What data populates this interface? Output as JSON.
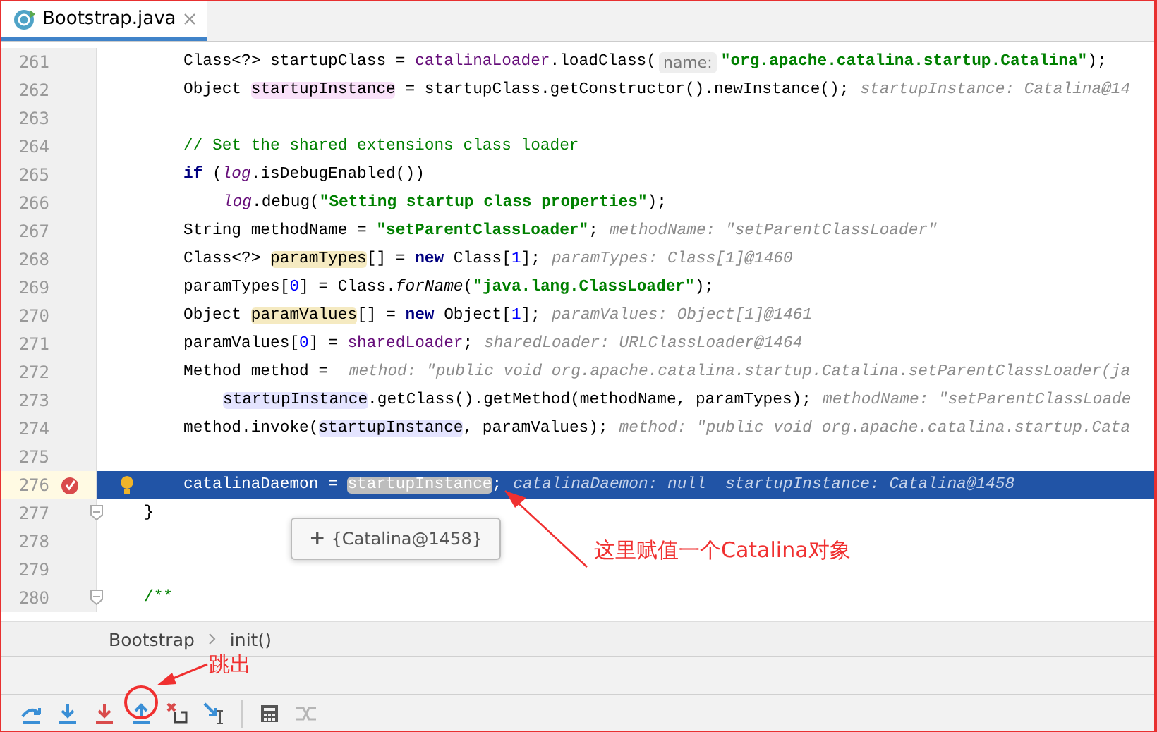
{
  "tabs": [
    {
      "label": "Bootstrap.java",
      "selected": true
    }
  ],
  "lines": [
    {
      "number": "261",
      "kind": "statement",
      "tokens": [
        {
          "text": "Class<?> startupClass = ",
          "kind": "plain"
        },
        {
          "text": "catalinaLoader",
          "kind": "field"
        },
        {
          "text": ".loadClass(",
          "kind": "plain"
        },
        {
          "text": "name:",
          "kind": "param"
        },
        {
          "text": "\"org.apache.catalina.startup.Catalina\"",
          "kind": "string"
        },
        {
          "text": ");",
          "kind": "plain"
        }
      ]
    },
    {
      "number": "262",
      "kind": "statement",
      "tokens": [
        {
          "text": "Object ",
          "kind": "plain"
        },
        {
          "text": "startupInstance",
          "kind": "plain",
          "declaration": true
        },
        {
          "text": " = startupClass.getConstructor().newInstance();",
          "kind": "plain"
        },
        {
          "text": "startupInstance: Catalina@14",
          "kind": "hint"
        }
      ]
    },
    {
      "number": "263",
      "kind": "statement"
    },
    {
      "number": "264",
      "kind": "statement",
      "tokens": [
        {
          "text": "// Set the shared extensions class loader",
          "kind": "comment"
        }
      ]
    },
    {
      "number": "265",
      "kind": "statement",
      "tokens": [
        {
          "text": "if",
          "kind": "keyword"
        },
        {
          "text": " (",
          "kind": "plain"
        },
        {
          "text": "log",
          "kind": "staticfield"
        },
        {
          "text": ".isDebugEnabled())",
          "kind": "plain"
        }
      ]
    },
    {
      "number": "266",
      "kind": "continuation",
      "tokens": [
        {
          "text": "log",
          "kind": "staticfield"
        },
        {
          "text": ".debug(",
          "kind": "plain"
        },
        {
          "text": "\"Setting startup class properties\"",
          "kind": "string"
        },
        {
          "text": ");",
          "kind": "plain"
        }
      ]
    },
    {
      "number": "267",
      "kind": "statement",
      "tokens": [
        {
          "text": "String methodName = ",
          "kind": "plain"
        },
        {
          "text": "\"setParentClassLoader\"",
          "kind": "string"
        },
        {
          "text": ";",
          "kind": "plain"
        },
        {
          "text": "methodName: \"setParentClassLoader\"",
          "kind": "hint"
        }
      ]
    },
    {
      "number": "268",
      "kind": "statement",
      "tokens": [
        {
          "text": "Class<?> ",
          "kind": "plain"
        },
        {
          "text": "paramTypes",
          "kind": "plain",
          "write_access": true
        },
        {
          "text": "[] = ",
          "kind": "plain"
        },
        {
          "text": "new",
          "kind": "keyword"
        },
        {
          "text": " Class[",
          "kind": "plain"
        },
        {
          "text": "1",
          "kind": "number"
        },
        {
          "text": "];",
          "kind": "plain"
        },
        {
          "text": "paramTypes: Class[1]@1460",
          "kind": "hint"
        }
      ]
    },
    {
      "number": "269",
      "kind": "statement",
      "tokens": [
        {
          "text": "paramTypes[",
          "kind": "plain"
        },
        {
          "text": "0",
          "kind": "number"
        },
        {
          "text": "] = Class.",
          "kind": "plain"
        },
        {
          "text": "forName",
          "kind": "static"
        },
        {
          "text": "(",
          "kind": "plain"
        },
        {
          "text": "\"java.lang.ClassLoader\"",
          "kind": "string"
        },
        {
          "text": ");",
          "kind": "plain"
        }
      ]
    },
    {
      "number": "270",
      "kind": "statement",
      "tokens": [
        {
          "text": "Object ",
          "kind": "plain"
        },
        {
          "text": "paramValues",
          "kind": "plain",
          "write_access": true
        },
        {
          "text": "[] = ",
          "kind": "plain"
        },
        {
          "text": "new",
          "kind": "keyword"
        },
        {
          "text": " Object[",
          "kind": "plain"
        },
        {
          "text": "1",
          "kind": "number"
        },
        {
          "text": "];",
          "kind": "plain"
        },
        {
          "text": "paramValues: Object[1]@1461",
          "kind": "hint"
        }
      ]
    },
    {
      "number": "271",
      "kind": "statement",
      "tokens": [
        {
          "text": "paramValues[",
          "kind": "plain"
        },
        {
          "text": "0",
          "kind": "number"
        },
        {
          "text": "] = ",
          "kind": "plain"
        },
        {
          "text": "sharedLoader",
          "kind": "field"
        },
        {
          "text": ";",
          "kind": "plain"
        },
        {
          "text": "sharedLoader: URLClassLoader@1464",
          "kind": "hint"
        }
      ]
    },
    {
      "number": "272",
      "kind": "statement",
      "tokens": [
        {
          "text": "Method method = ",
          "kind": "plain"
        },
        {
          "text": "method: \"public void org.apache.catalina.startup.Catalina.setParentClassLoader(ja",
          "kind": "hint"
        }
      ]
    },
    {
      "number": "273",
      "kind": "continuation",
      "tokens": [
        {
          "text": "startupInstance",
          "kind": "plain",
          "read_access": true
        },
        {
          "text": ".getClass().getMethod(methodName, paramTypes);",
          "kind": "plain"
        },
        {
          "text": "methodName: \"setParentClassLoade",
          "kind": "hint"
        }
      ]
    },
    {
      "number": "274",
      "kind": "statement",
      "tokens": [
        {
          "text": "method.invoke(",
          "kind": "plain"
        },
        {
          "text": "startupInstance",
          "kind": "plain",
          "read_access": true
        },
        {
          "text": ", paramValues);",
          "kind": "plain"
        },
        {
          "text": "method: \"public void org.apache.catalina.startup.Cata",
          "kind": "hint"
        }
      ]
    },
    {
      "number": "275",
      "kind": "statement"
    },
    {
      "number": "276",
      "kind": "statement",
      "current": true,
      "breakpoint": true,
      "intention": true,
      "tokens": [
        {
          "text": "catalinaDaemon = ",
          "kind": "plain"
        },
        {
          "text": "startupInstance",
          "kind": "plain",
          "selected": true
        },
        {
          "text": ";",
          "kind": "plain"
        },
        {
          "text": "catalinaDaemon: null  startupInstance: Catalina@1458",
          "kind": "hint"
        }
      ]
    },
    {
      "number": "277",
      "kind": "closing",
      "fold": true,
      "tokens": [
        {
          "text": "}",
          "kind": "plain"
        }
      ]
    },
    {
      "number": "278",
      "kind": "statement"
    },
    {
      "number": "279",
      "kind": "statement"
    },
    {
      "number": "280",
      "kind": "closing",
      "fold": true,
      "tokens": [
        {
          "text": "/**",
          "kind": "comment"
        }
      ]
    }
  ],
  "tooltip": {
    "icon": "+",
    "value": "{Catalina@1458}"
  },
  "breadcrumbs": [
    "Bootstrap",
    "init()"
  ],
  "toolbar": [
    {
      "kind": "step-over",
      "disabled": false
    },
    {
      "kind": "step-into",
      "disabled": false
    },
    {
      "kind": "force-step-into",
      "disabled": false
    },
    {
      "kind": "step-out",
      "disabled": false
    },
    {
      "kind": "drop-frame",
      "disabled": false
    },
    {
      "kind": "run-to-cursor",
      "disabled": false
    },
    {
      "kind": "separator"
    },
    {
      "kind": "evaluate",
      "disabled": false
    },
    {
      "kind": "trace",
      "disabled": true
    }
  ],
  "annotations": [
    {
      "kind": "value-callout",
      "text": "这里赋值一个Catalina对象"
    },
    {
      "kind": "button-callout",
      "text": "跳出"
    }
  ]
}
